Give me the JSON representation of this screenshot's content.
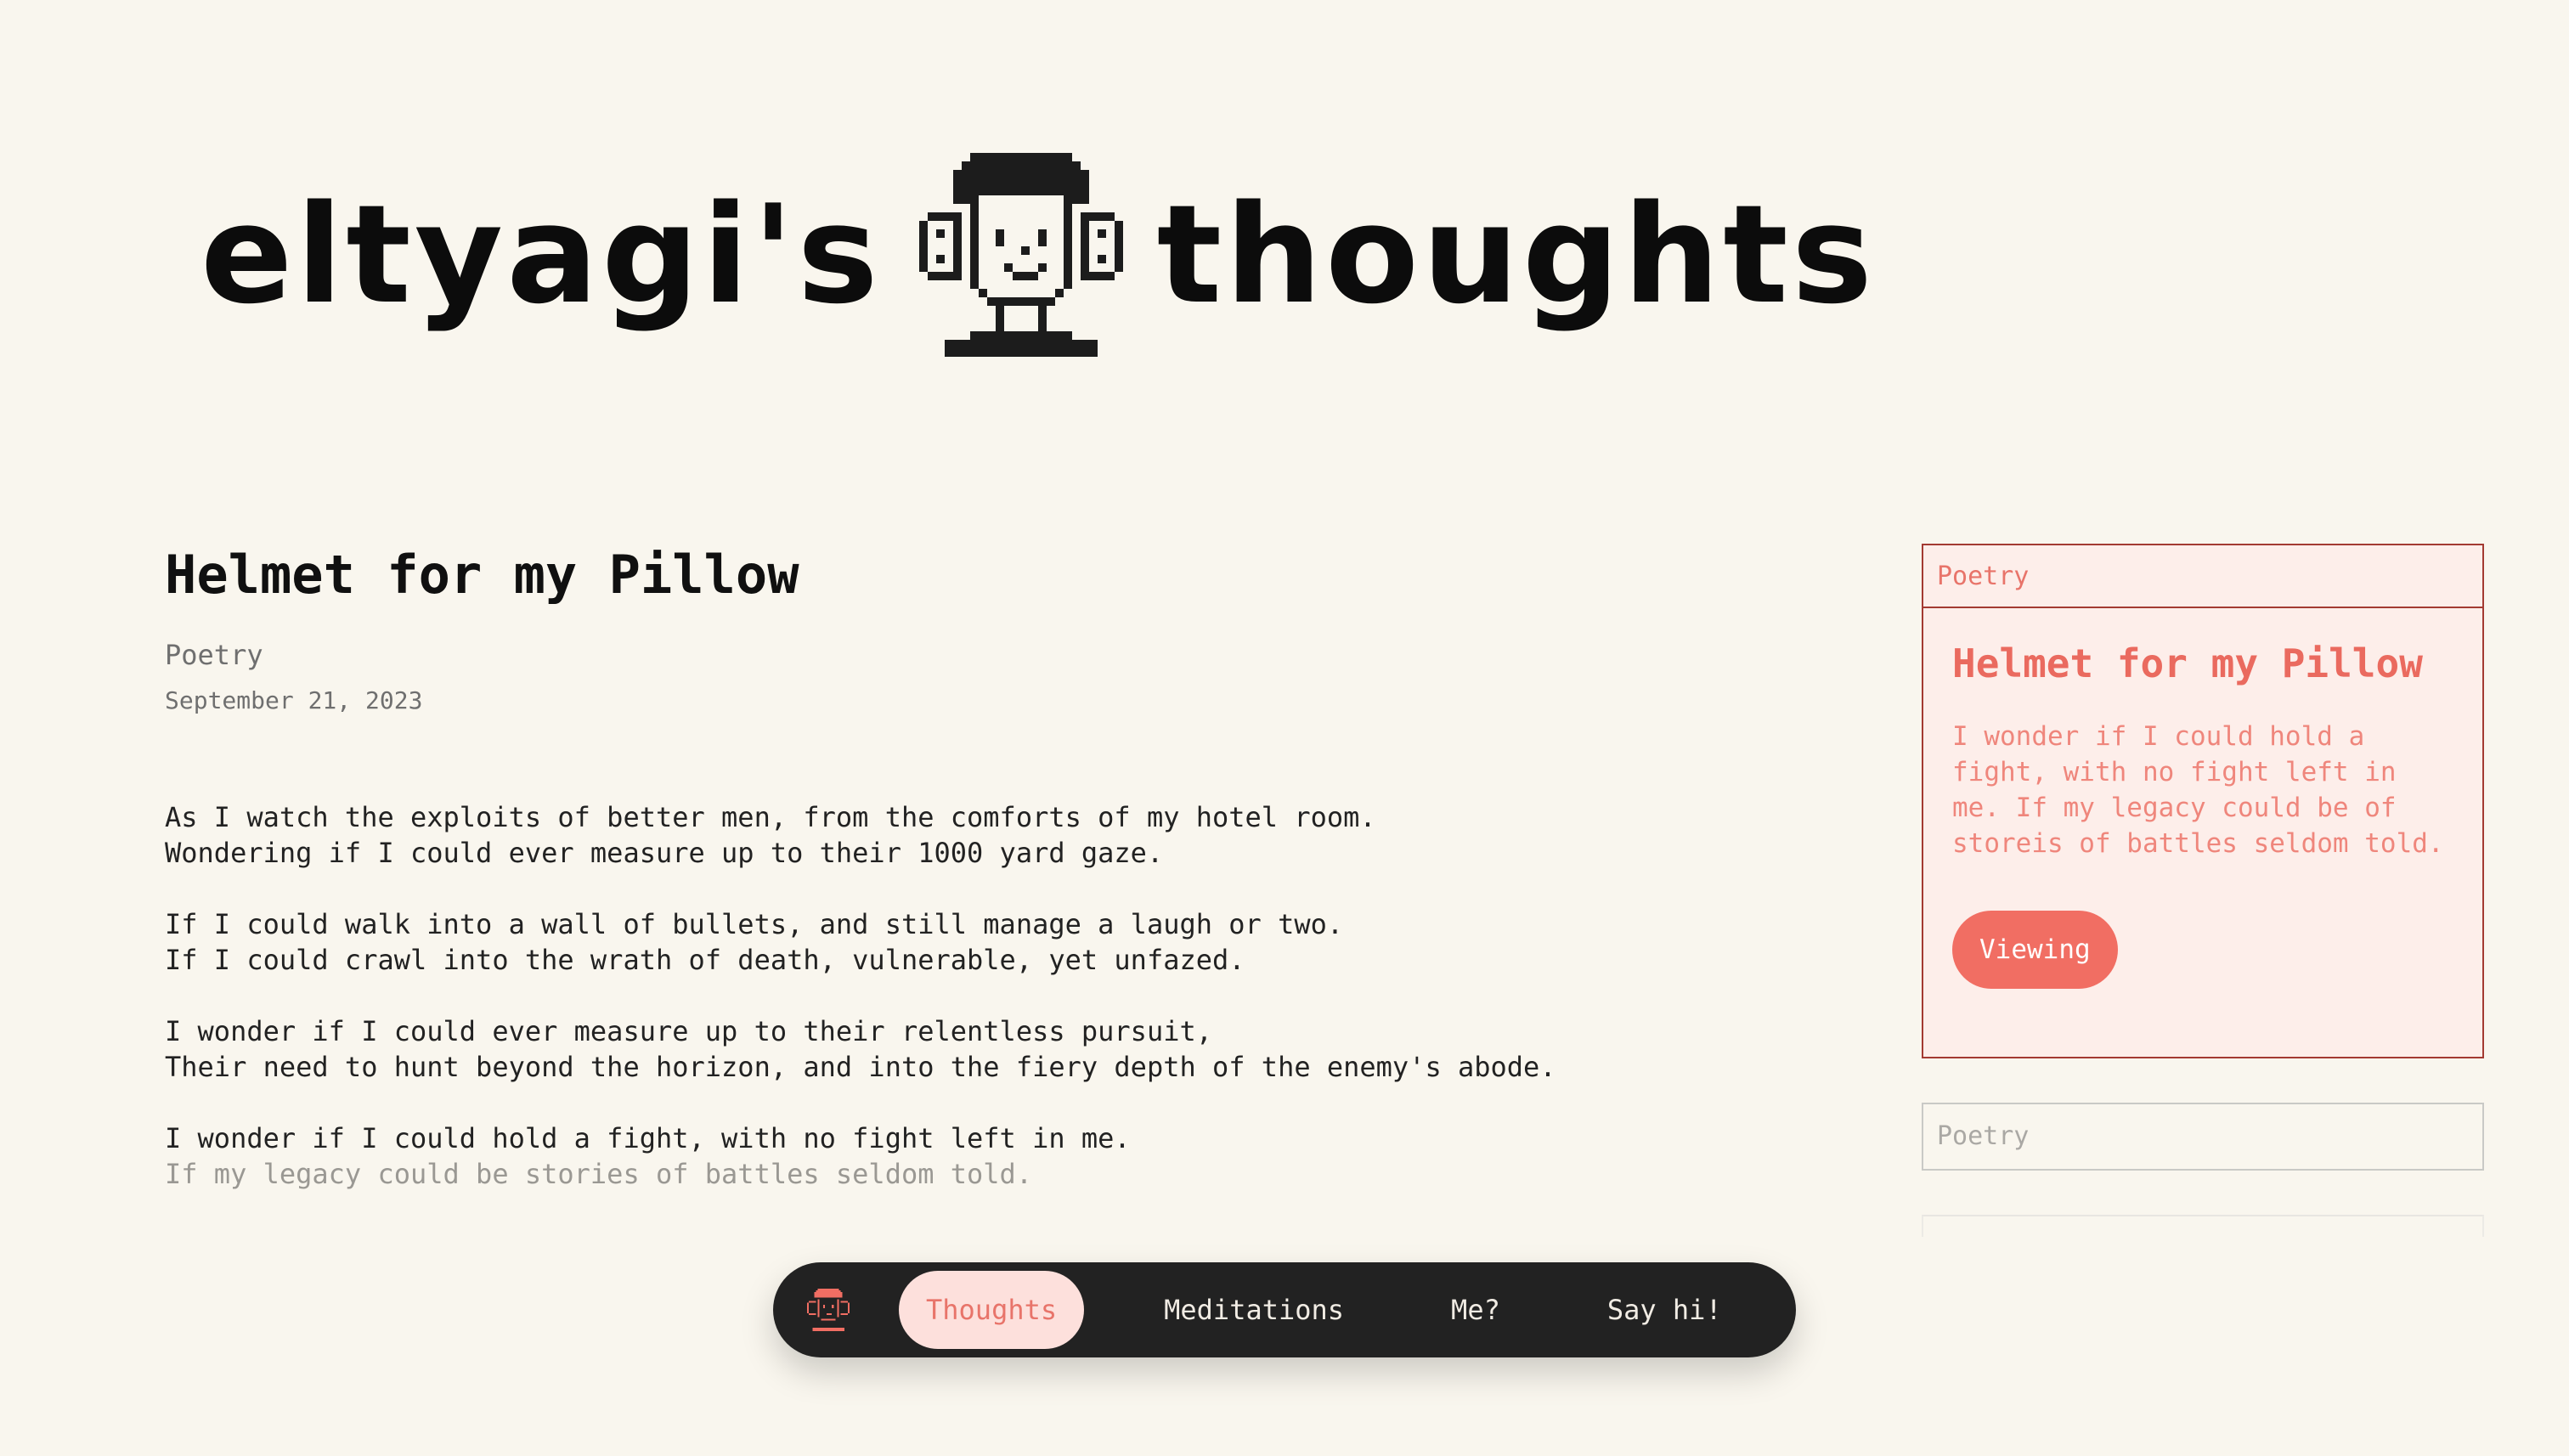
{
  "header": {
    "title_left": "eltyagi's",
    "title_right": "thoughts",
    "avatar_icon": "pixel-avatar-icon"
  },
  "article": {
    "title": "Helmet for my Pillow",
    "category": "Poetry",
    "date": "September 21, 2023",
    "stanzas": [
      [
        "As I watch the exploits of better men, from the comforts of my hotel room.",
        "Wondering if I could ever measure up to their 1000 yard gaze."
      ],
      [
        "If I could walk into a wall of bullets, and still manage a laugh or two.",
        "If I could crawl into the wrath of death, vulnerable, yet unfazed."
      ],
      [
        "I wonder if I could ever measure up to their relentless pursuit,",
        "Their need to hunt beyond the horizon, and into the fiery depth of the enemy's abode."
      ],
      [
        "I wonder if I could hold a fight, with no fight left in me.",
        "If my legacy could be stories of battles seldom told."
      ]
    ]
  },
  "sidebar": {
    "active_card": {
      "tag": "Poetry",
      "title": "Helmet for my Pillow",
      "excerpt": "I wonder if I could hold a fight, with no fight left in me. If my legacy could be of storeis of battles seldom told.",
      "button_label": "Viewing"
    },
    "next_card": {
      "tag": "Poetry"
    }
  },
  "nav": {
    "logo_icon": "avatar-logo-icon",
    "items": [
      {
        "label": "Thoughts",
        "active": true
      },
      {
        "label": "Meditations",
        "active": false
      },
      {
        "label": "Me?",
        "active": false
      },
      {
        "label": "Say hi!",
        "active": false
      }
    ]
  },
  "colors": {
    "background": "#f9f6ee",
    "accent": "#f16e63",
    "card_border": "#a33a32",
    "card_background": "#fdeeea",
    "nav_background": "#222222"
  }
}
